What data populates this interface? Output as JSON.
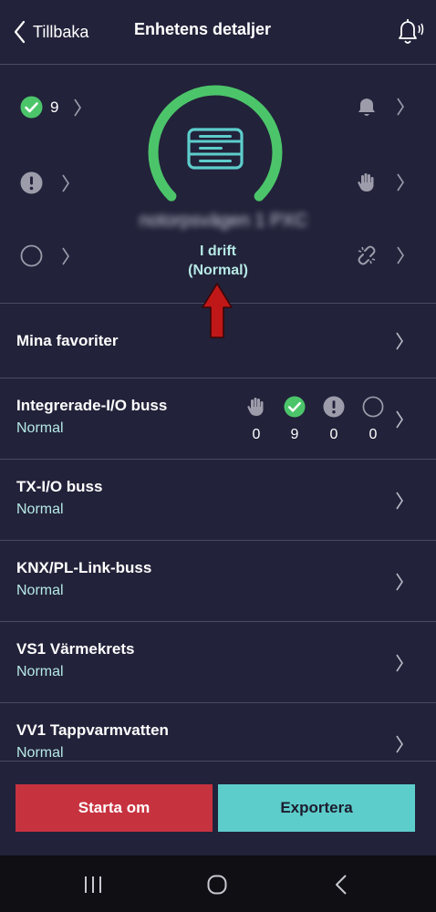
{
  "header": {
    "back_label": "Tillbaka",
    "title": "Enhetens detaljer"
  },
  "status": {
    "ok_count": "9",
    "device_name": "notorpsvägen 1 PXC",
    "operating_state": "I drift",
    "operating_state_detail": "(Normal)",
    "colors": {
      "ok": "#4cc56a",
      "gauge": "#4cc56a",
      "device_icon": "#5dcdcb",
      "arrow": "#c01818"
    }
  },
  "list": {
    "favorites": {
      "title": "Mina favoriter"
    },
    "items": [
      {
        "title": "Integrerade-I/O buss",
        "status": "Normal",
        "counts": [
          "0",
          "9",
          "0",
          "0"
        ]
      },
      {
        "title": "TX-I/O buss",
        "status": "Normal"
      },
      {
        "title": "KNX/PL-Link-buss",
        "status": "Normal"
      },
      {
        "title": "VS1 Värmekrets",
        "status": "Normal"
      },
      {
        "title": "VV1 Tappvarmvatten",
        "status": "Normal"
      }
    ]
  },
  "actions": {
    "restart_label": "Starta om",
    "export_label": "Exportera"
  },
  "icons": [
    "back-chevron-icon",
    "bell-sound-icon",
    "check-circle-icon",
    "exclamation-circle-icon",
    "empty-circle-icon",
    "bell-icon",
    "hand-icon",
    "broken-link-icon",
    "device-icon",
    "chevron-right-icon",
    "recents-icon",
    "home-icon",
    "nav-back-icon"
  ]
}
